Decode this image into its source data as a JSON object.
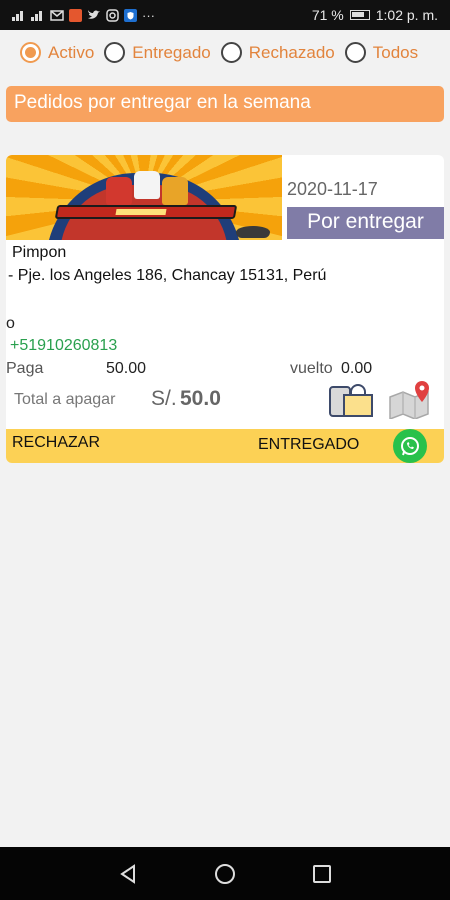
{
  "status_bar": {
    "battery": "71 %",
    "time": "1:02 p. m.",
    "more": "···",
    "icons": [
      "signal-icon",
      "signal-icon",
      "mail-icon",
      "app-icon",
      "twitter-icon",
      "instagram-icon",
      "shield-icon",
      "more-icon",
      "battery-icon"
    ]
  },
  "filters": [
    {
      "label": "Activo",
      "selected": true
    },
    {
      "label": "Entregado",
      "selected": false
    },
    {
      "label": "Rechazado",
      "selected": false
    },
    {
      "label": "Todos",
      "selected": false
    }
  ],
  "banner": {
    "title": "Pedidos por entregar en la semana"
  },
  "order": {
    "date": "2020-11-17",
    "status": "Por entregar",
    "customer": "Pimpon",
    "address": "- Pje. los Angeles 186, Chancay 15131, Perú",
    "reference": "o",
    "phone": "+51910260813",
    "pay_label": "Paga",
    "pay_value": "50.00",
    "change_label": "vuelto",
    "change_value": "0.00",
    "total_label": "Total a apagar",
    "currency": "S/.",
    "total_value": "50.0",
    "reject_label": "RECHAZAR",
    "delivered_label": "ENTREGADO"
  },
  "colors": {
    "accent": "#f09a4f",
    "banner": "#f8a25f",
    "status": "#807ca7",
    "action_bar": "#fcd155",
    "phone": "#2aa04e",
    "whatsapp": "#29c14b"
  }
}
